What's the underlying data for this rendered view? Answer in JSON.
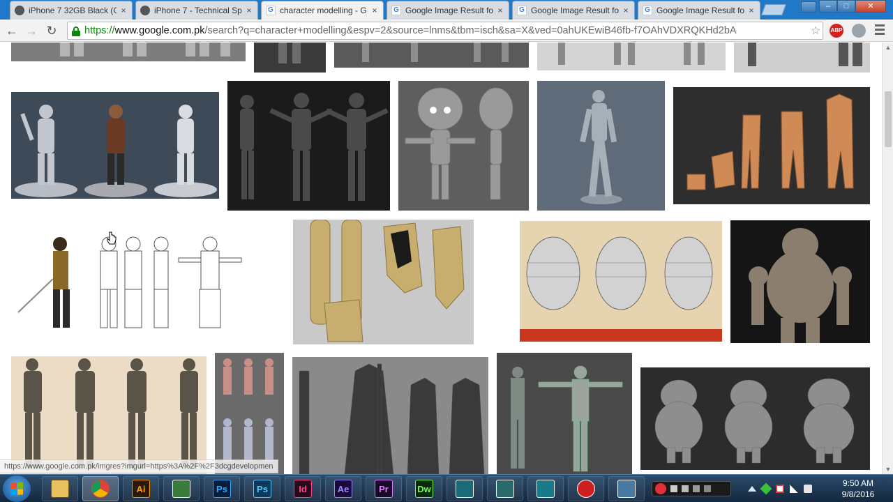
{
  "browser": {
    "tabs": [
      {
        "title": "iPhone 7 32GB Black (G",
        "icon": "apple-icon"
      },
      {
        "title": "iPhone 7 - Technical Sp",
        "icon": "apple-icon"
      },
      {
        "title": "character modelling - G",
        "icon": "google-icon",
        "active": true
      },
      {
        "title": "Google Image Result fo",
        "icon": "google-icon"
      },
      {
        "title": "Google Image Result fo",
        "icon": "google-icon"
      },
      {
        "title": "Google Image Result fo",
        "icon": "google-icon"
      }
    ],
    "close_glyph": "×",
    "url": {
      "scheme": "https://",
      "host": "www.google.com.pk",
      "rest": "/search?q=character+modelling&espv=2&source=lnms&tbm=isch&sa=X&ved=0ahUKEwiB46fb-f7OAhVDXRQKHd2bA"
    },
    "extension_label": "ABP",
    "status_text": "https://www.google.com.pk/imgres?imgurl=https%3A%2F%2F3dcgdevelopmen"
  },
  "taskbar": {
    "apps": [
      {
        "name": "explorer",
        "label": "",
        "bg": "#e8c060",
        "fg": "#7a5a10"
      },
      {
        "name": "chrome",
        "label": "",
        "bg": "#ffffff",
        "fg": "#db4437",
        "active": true
      },
      {
        "name": "illustrator",
        "label": "Ai",
        "bg": "#2b1a0a",
        "fg": "#ff9a00"
      },
      {
        "name": "sketchup",
        "label": "",
        "bg": "#3a7a3a",
        "fg": "#ffffff"
      },
      {
        "name": "photoshop",
        "label": "Ps",
        "bg": "#061e3c",
        "fg": "#31a8ff"
      },
      {
        "name": "photoshop-2",
        "label": "Ps",
        "bg": "#0d3a5a",
        "fg": "#5ec8ff"
      },
      {
        "name": "indesign",
        "label": "Id",
        "bg": "#2a0a1a",
        "fg": "#ff3f8f"
      },
      {
        "name": "after-effects",
        "label": "Ae",
        "bg": "#1a0a3a",
        "fg": "#9a8aff"
      },
      {
        "name": "premiere",
        "label": "Pr",
        "bg": "#1a0a2a",
        "fg": "#e07aff"
      },
      {
        "name": "dreamweaver",
        "label": "Dw",
        "bg": "#0a2a0a",
        "fg": "#70ff50"
      },
      {
        "name": "3ds-max",
        "label": "",
        "bg": "#1a6a7a",
        "fg": "#ffffff"
      },
      {
        "name": "app-swirl",
        "label": "",
        "bg": "#2a6a6a",
        "fg": "#ffffff"
      },
      {
        "name": "maya",
        "label": "",
        "bg": "#1a7a8a",
        "fg": "#ffffff"
      },
      {
        "name": "recorder",
        "label": "",
        "bg": "#cc2020",
        "fg": "#ffffff"
      },
      {
        "name": "screen-capture",
        "label": "",
        "bg": "#4a7aa0",
        "fg": "#ffffff"
      }
    ],
    "clock": {
      "time": "9:50 AM",
      "date": "9/8/2016"
    }
  },
  "colors": {
    "titlebar": "#1f78c8",
    "accent_green": "#0a8a0a"
  }
}
